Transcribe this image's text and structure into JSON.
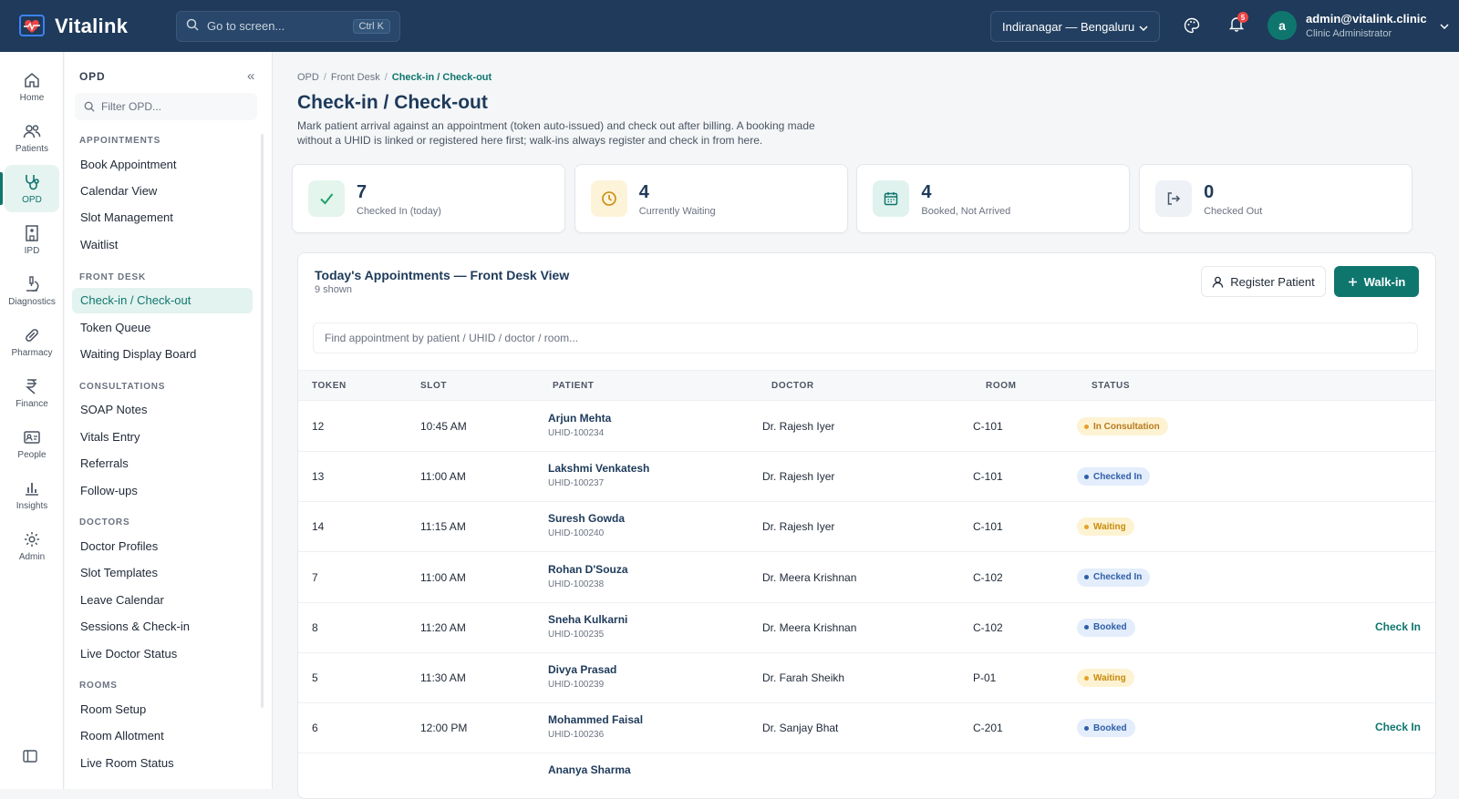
{
  "app": {
    "name": "Vitalink"
  },
  "topbar": {
    "search_placeholder": "Go to screen...",
    "search_shortcut": "Ctrl K",
    "location": "Indiranagar — Bengaluru",
    "notifications_count": "5",
    "user_initial": "a",
    "user_email": "admin@vitalink.clinic",
    "user_role": "Clinic Administrator"
  },
  "rail": [
    {
      "label": "Home"
    },
    {
      "label": "Patients"
    },
    {
      "label": "OPD"
    },
    {
      "label": "IPD"
    },
    {
      "label": "Diagnostics"
    },
    {
      "label": "Pharmacy"
    },
    {
      "label": "Finance"
    },
    {
      "label": "People"
    },
    {
      "label": "Insights"
    },
    {
      "label": "Admin"
    }
  ],
  "sidebar": {
    "heading": "OPD",
    "filter_placeholder": "Filter OPD...",
    "sections": [
      {
        "title": "APPOINTMENTS",
        "items": [
          "Book Appointment",
          "Calendar View",
          "Slot Management",
          "Waitlist"
        ]
      },
      {
        "title": "FRONT DESK",
        "items": [
          "Check-in / Check-out",
          "Token Queue",
          "Waiting Display Board"
        ]
      },
      {
        "title": "CONSULTATIONS",
        "items": [
          "SOAP Notes",
          "Vitals Entry",
          "Referrals",
          "Follow-ups"
        ]
      },
      {
        "title": "DOCTORS",
        "items": [
          "Doctor Profiles",
          "Slot Templates",
          "Leave Calendar",
          "Sessions & Check-in",
          "Live Doctor Status"
        ]
      },
      {
        "title": "ROOMS",
        "items": [
          "Room Setup",
          "Room Allotment",
          "Live Room Status"
        ]
      }
    ]
  },
  "breadcrumb": {
    "items": [
      "OPD",
      "Front Desk",
      "Check-in / Check-out"
    ]
  },
  "page": {
    "title": "Check-in / Check-out",
    "description": "Mark patient arrival against an appointment (token auto-issued) and check out after billing. A booking made without a UHID is linked or registered here first; walk-ins always register and check in from here."
  },
  "stats": [
    {
      "value": "7",
      "label": "Checked In (today)",
      "color": "#22a06b",
      "bg": "#e3f5ec"
    },
    {
      "value": "4",
      "label": "Currently Waiting",
      "color": "#c88a0c",
      "bg": "#fdf3d9"
    },
    {
      "value": "4",
      "label": "Booked, Not Arrived",
      "color": "#0f766e",
      "bg": "#e0f2ee"
    },
    {
      "value": "0",
      "label": "Checked Out",
      "color": "#475569",
      "bg": "#eef1f5"
    }
  ],
  "panel": {
    "title": "Today's Appointments — Front Desk View",
    "subtitle": "9 shown",
    "register_label": "Register Patient",
    "walkin_label": "Walk-in",
    "search_placeholder": "Find appointment by patient / UHID / doctor / room..."
  },
  "table": {
    "columns": [
      "TOKEN",
      "SLOT",
      "PATIENT",
      "DOCTOR",
      "ROOM",
      "STATUS"
    ],
    "rows": [
      {
        "token": "12",
        "slot": "10:45 AM",
        "patient": "Arjun Mehta",
        "uhid": "UHID-100234",
        "doctor": "Dr. Rajesh Iyer",
        "room": "C-101",
        "status": "In Consultation",
        "action": ""
      },
      {
        "token": "13",
        "slot": "11:00 AM",
        "patient": "Lakshmi Venkatesh",
        "uhid": "UHID-100237",
        "doctor": "Dr. Rajesh Iyer",
        "room": "C-101",
        "status": "Checked In",
        "action": ""
      },
      {
        "token": "14",
        "slot": "11:15 AM",
        "patient": "Suresh Gowda",
        "uhid": "UHID-100240",
        "doctor": "Dr. Rajesh Iyer",
        "room": "C-101",
        "status": "Waiting",
        "action": ""
      },
      {
        "token": "7",
        "slot": "11:00 AM",
        "patient": "Rohan D'Souza",
        "uhid": "UHID-100238",
        "doctor": "Dr. Meera Krishnan",
        "room": "C-102",
        "status": "Checked In",
        "action": ""
      },
      {
        "token": "8",
        "slot": "11:20 AM",
        "patient": "Sneha Kulkarni",
        "uhid": "UHID-100235",
        "doctor": "Dr. Meera Krishnan",
        "room": "C-102",
        "status": "Booked",
        "action": "Check In"
      },
      {
        "token": "5",
        "slot": "11:30 AM",
        "patient": "Divya Prasad",
        "uhid": "UHID-100239",
        "doctor": "Dr. Farah Sheikh",
        "room": "P-01",
        "status": "Waiting",
        "action": ""
      },
      {
        "token": "6",
        "slot": "12:00 PM",
        "patient": "Mohammed Faisal",
        "uhid": "UHID-100236",
        "doctor": "Dr. Sanjay Bhat",
        "room": "C-201",
        "status": "Booked",
        "action": "Check In"
      },
      {
        "token": "",
        "slot": "",
        "patient": "Ananya Sharma",
        "uhid": "",
        "doctor": "",
        "room": "",
        "status": "",
        "action": ""
      }
    ]
  },
  "status_styles": {
    "In Consultation": {
      "bg": "#fdf3d3",
      "fg": "#b7791f",
      "dot": "#e6a12a"
    },
    "Checked In": {
      "bg": "#e3edfb",
      "fg": "#2f5ea8",
      "dot": "#2f5ea8"
    },
    "Waiting": {
      "bg": "#fdf3d3",
      "fg": "#c88a0c",
      "dot": "#e6a12a"
    },
    "Booked": {
      "bg": "#e3edfb",
      "fg": "#2f5ea8",
      "dot": "#2f5ea8"
    }
  },
  "icons": {
    "logo": "heart-monitor-icon",
    "search": "search-icon",
    "location_chevron": "chevron-down-icon",
    "palette": "palette-icon",
    "bell": "bell-icon",
    "user_chevron": "chevron-down-icon",
    "collapse": "double-chevron-left-icon",
    "sidebar_toggle": "panel-icon"
  }
}
